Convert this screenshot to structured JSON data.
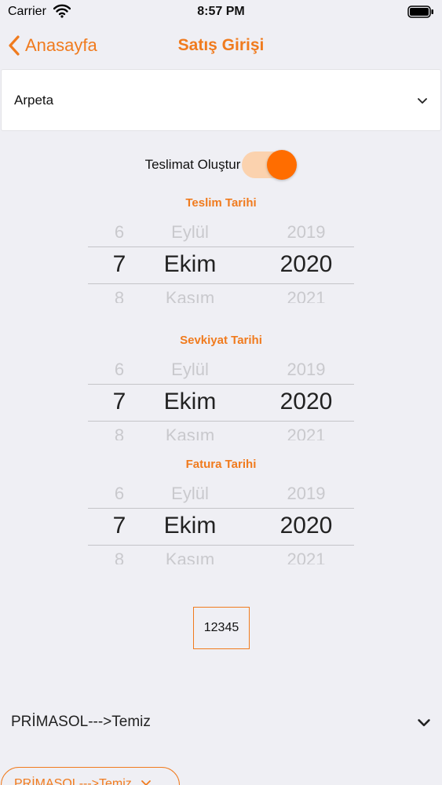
{
  "status_bar": {
    "carrier": "Carrier",
    "time": "8:57 PM"
  },
  "nav": {
    "back_label": "Anasayfa",
    "title": "Satış Girişi"
  },
  "company_select": {
    "value": "Arpeta"
  },
  "delivery_toggle": {
    "label": "Teslimat Oluştur",
    "on": true
  },
  "pickers": [
    {
      "label": "Teslim Tarihi",
      "day": [
        "6",
        "7",
        "8"
      ],
      "month": [
        "Eylül",
        "Ekim",
        "Kasım"
      ],
      "year": [
        "2019",
        "2020",
        "2021"
      ]
    },
    {
      "label": "Sevkiyat Tarihi",
      "day": [
        "6",
        "7",
        "8"
      ],
      "month": [
        "Eylül",
        "Ekim",
        "Kasım"
      ],
      "year": [
        "2019",
        "2020",
        "2021"
      ]
    },
    {
      "label": "Fatura Tarihi",
      "day": [
        "6",
        "7",
        "8"
      ],
      "month": [
        "Eylül",
        "Ekim",
        "Kasım"
      ],
      "year": [
        "2019",
        "2020",
        "2021"
      ]
    }
  ],
  "number_field": {
    "value": "12345"
  },
  "product_select": {
    "value": "PRİMASOL--->Temiz"
  },
  "product_chip": {
    "label": "PRİMASOL--->Temiz"
  },
  "colors": {
    "accent": "#f07b1e",
    "toggle_knob": "#ff6d00",
    "background": "#efeff4"
  },
  "icons": [
    "wifi-icon",
    "battery-icon",
    "back-chevron-icon",
    "chevron-down-icon",
    "chip-close-icon"
  ]
}
